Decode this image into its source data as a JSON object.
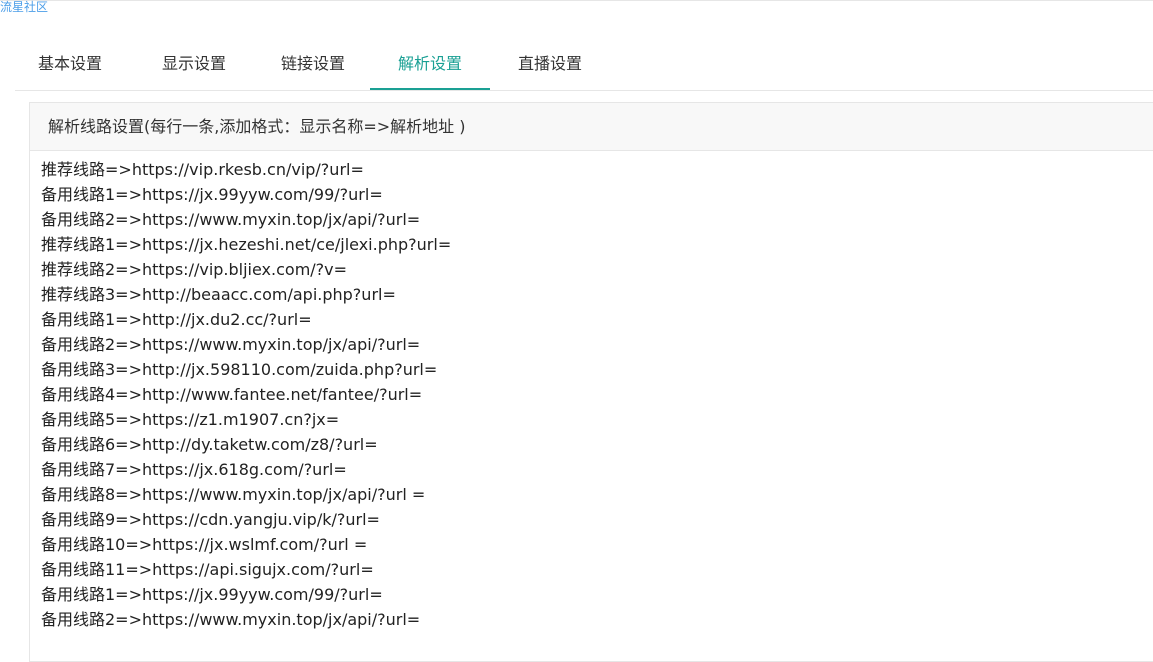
{
  "site": {
    "name": "流星社区"
  },
  "tabs": [
    {
      "label": "基本设置",
      "active": false
    },
    {
      "label": "显示设置",
      "active": false
    },
    {
      "label": "链接设置",
      "active": false
    },
    {
      "label": "解析设置",
      "active": true
    },
    {
      "label": "直播设置",
      "active": false
    }
  ],
  "panel": {
    "title": "解析线路设置(每行一条,添加格式：显示名称=>解析地址 )",
    "lines": [
      "推荐线路=>https://vip.rkesb.cn/vip/?url=",
      "备用线路1=>https://jx.99yyw.com/99/?url=",
      "备用线路2=>https://www.myxin.top/jx/api/?url=",
      "推荐线路1=>https://jx.hezeshi.net/ce/jlexi.php?url=",
      "推荐线路2=>https://vip.bljiex.com/?v=",
      "推荐线路3=>http://beaacc.com/api.php?url=",
      "备用线路1=>http://jx.du2.cc/?url=",
      "备用线路2=>https://www.myxin.top/jx/api/?url=",
      "备用线路3=>http://jx.598110.com/zuida.php?url=",
      "备用线路4=>http://www.fantee.net/fantee/?url=",
      "备用线路5=>https://z1.m1907.cn?jx=",
      "备用线路6=>http://dy.taketw.com/z8/?url=",
      "备用线路7=>https://jx.618g.com/?url=",
      "备用线路8=>https://www.myxin.top/jx/api/?url =",
      "备用线路9=>https://cdn.yangju.vip/k/?url=",
      "备用线路10=>https://jx.wslmf.com/?url =",
      "备用线路11=>https://api.sigujx.com/?url=",
      "备用线路1=>https://jx.99yyw.com/99/?url=",
      "备用线路2=>https://www.myxin.top/jx/api/?url="
    ]
  },
  "colors": {
    "accent": "#1aa094",
    "link": "#4c9ee8",
    "border": "#e6e6e6",
    "header_bg": "#f8f8f8"
  }
}
